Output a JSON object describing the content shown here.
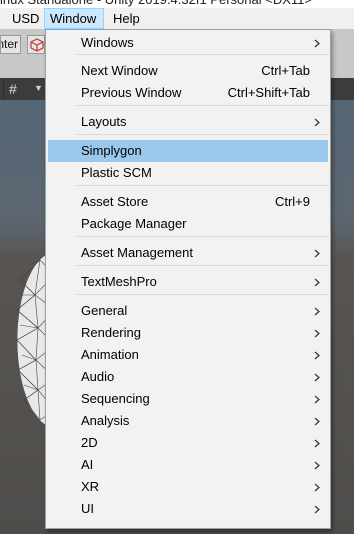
{
  "window_title": "inux Standalone - Unity 2019.4.32f1 Personal <DX11>",
  "menubar": {
    "usd": "USD",
    "window": "Window",
    "help": "Help"
  },
  "toolbar": {
    "pivot_label": "nter"
  },
  "window_menu": {
    "items": [
      {
        "label": "Windows",
        "shortcut": "",
        "submenu": true
      },
      {
        "label": "Next Window",
        "shortcut": "Ctrl+Tab",
        "submenu": false
      },
      {
        "label": "Previous Window",
        "shortcut": "Ctrl+Shift+Tab",
        "submenu": false
      },
      {
        "label": "Layouts",
        "shortcut": "",
        "submenu": true
      },
      {
        "label": "Simplygon",
        "shortcut": "",
        "submenu": false,
        "highlighted": true
      },
      {
        "label": "Plastic SCM",
        "shortcut": "",
        "submenu": false
      },
      {
        "label": "Asset Store",
        "shortcut": "Ctrl+9",
        "submenu": false
      },
      {
        "label": "Package Manager",
        "shortcut": "",
        "submenu": false
      },
      {
        "label": "Asset Management",
        "shortcut": "",
        "submenu": true
      },
      {
        "label": "TextMeshPro",
        "shortcut": "",
        "submenu": true
      },
      {
        "label": "General",
        "shortcut": "",
        "submenu": true
      },
      {
        "label": "Rendering",
        "shortcut": "",
        "submenu": true
      },
      {
        "label": "Animation",
        "shortcut": "",
        "submenu": true
      },
      {
        "label": "Audio",
        "shortcut": "",
        "submenu": true
      },
      {
        "label": "Sequencing",
        "shortcut": "",
        "submenu": true
      },
      {
        "label": "Analysis",
        "shortcut": "",
        "submenu": true
      },
      {
        "label": "2D",
        "shortcut": "",
        "submenu": true
      },
      {
        "label": "AI",
        "shortcut": "",
        "submenu": true
      },
      {
        "label": "XR",
        "shortcut": "",
        "submenu": true
      },
      {
        "label": "UI",
        "shortcut": "",
        "submenu": true
      }
    ]
  },
  "colors": {
    "menu_background": "#f2f2f2",
    "highlight": "#99c9ef",
    "menubar_active": "#cce8ff"
  }
}
